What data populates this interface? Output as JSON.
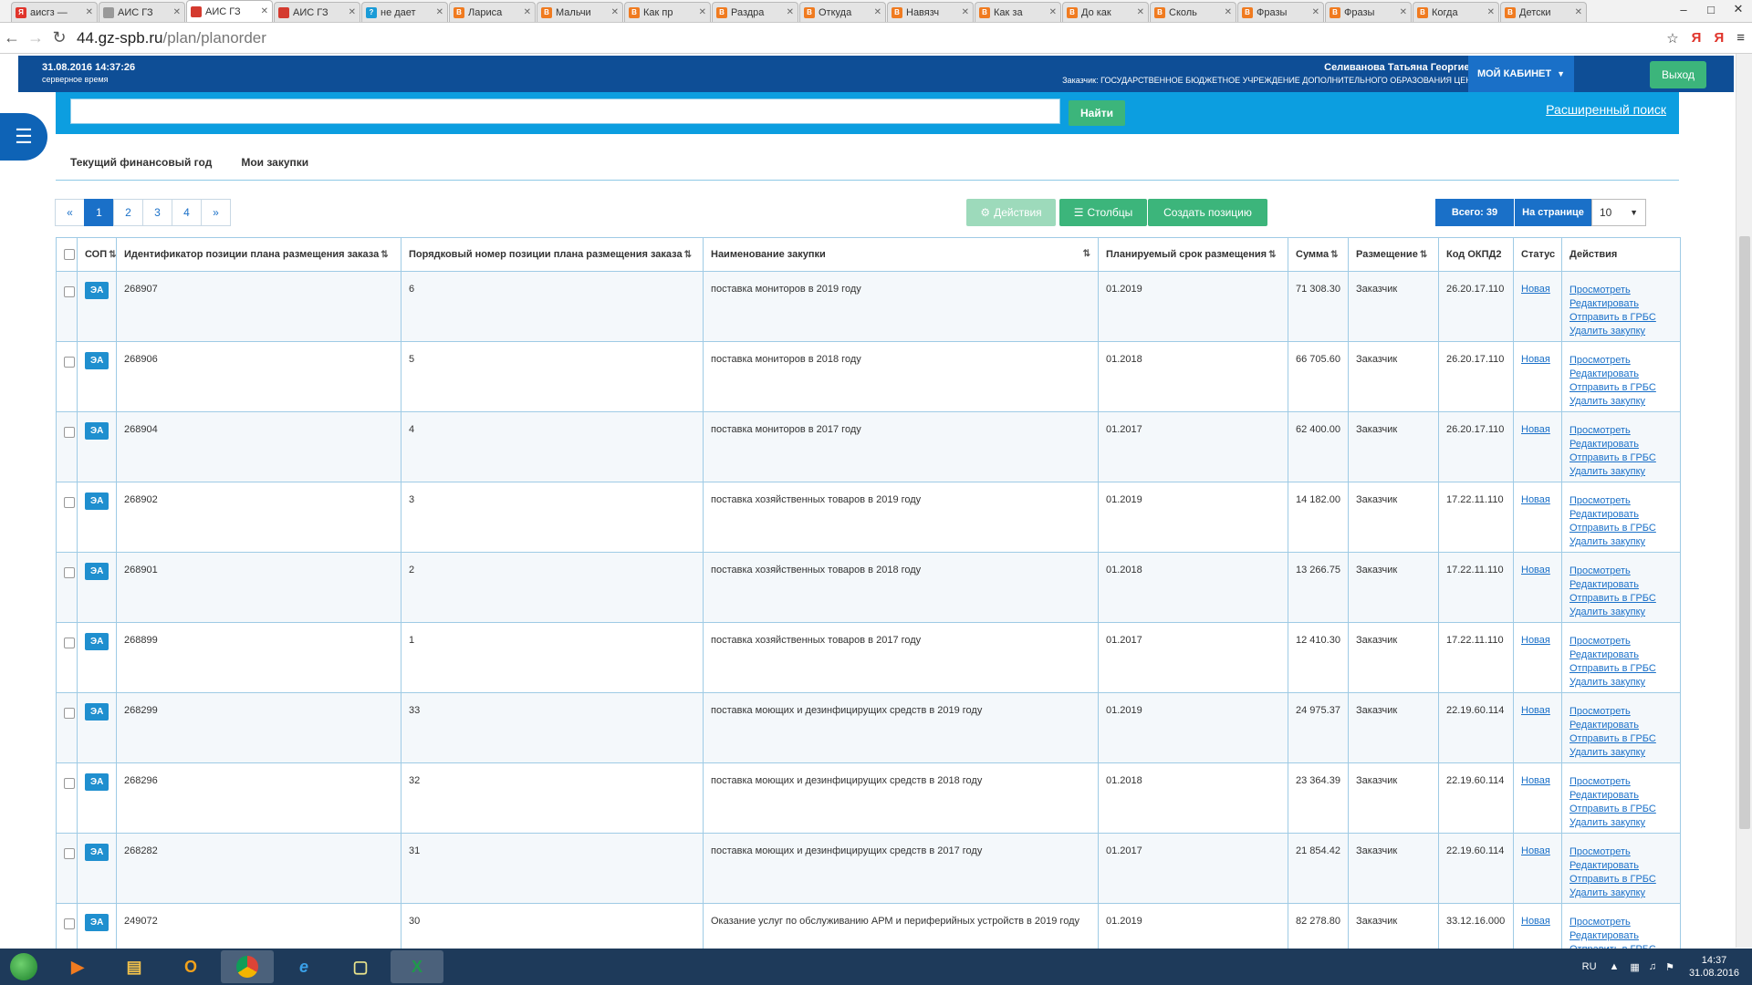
{
  "browser": {
    "tabs": [
      {
        "title": "аисгз —",
        "color": "#e0342b",
        "glyph": "Я",
        "active": false
      },
      {
        "title": "АИС ГЗ",
        "color": "#999999",
        "glyph": "",
        "active": false
      },
      {
        "title": "АИС ГЗ",
        "color": "#d43a2f",
        "glyph": "",
        "active": true
      },
      {
        "title": "АИС ГЗ",
        "color": "#d43a2f",
        "glyph": "",
        "active": false
      },
      {
        "title": "не дает",
        "color": "#1a9bd7",
        "glyph": "?",
        "active": false
      },
      {
        "title": "Лариса",
        "color": "#f07b20",
        "glyph": "B",
        "active": false
      },
      {
        "title": "Мальчи",
        "color": "#f07b20",
        "glyph": "B",
        "active": false
      },
      {
        "title": "Как пр",
        "color": "#f07b20",
        "glyph": "B",
        "active": false
      },
      {
        "title": "Раздра",
        "color": "#f07b20",
        "glyph": "B",
        "active": false
      },
      {
        "title": "Откуда",
        "color": "#f07b20",
        "glyph": "B",
        "active": false
      },
      {
        "title": "Навязч",
        "color": "#f07b20",
        "glyph": "B",
        "active": false
      },
      {
        "title": "Как за",
        "color": "#f07b20",
        "glyph": "B",
        "active": false
      },
      {
        "title": "До как",
        "color": "#f07b20",
        "glyph": "B",
        "active": false
      },
      {
        "title": "Сколь",
        "color": "#f07b20",
        "glyph": "B",
        "active": false
      },
      {
        "title": "Фразы",
        "color": "#f07b20",
        "glyph": "B",
        "active": false
      },
      {
        "title": "Фразы",
        "color": "#f07b20",
        "glyph": "B",
        "active": false
      },
      {
        "title": "Когда",
        "color": "#f07b20",
        "glyph": "B",
        "active": false
      },
      {
        "title": "Детски",
        "color": "#f07b20",
        "glyph": "B",
        "active": false
      }
    ],
    "url_host": "44.gz-spb.ru",
    "url_path": "/plan/planorder"
  },
  "header": {
    "server_time": "31.08.2016 14:37:26",
    "server_time_label": "серверное время",
    "user_name": "Селиванова Татьяна Георгиевна",
    "customer": "Заказчик: ГОСУДАРСТВЕННОЕ БЮДЖЕТНОЕ УЧРЕЖДЕНИЕ ДОПОЛНИТЕЛЬНОГО ОБРАЗОВАНИЯ ЦЕНТР...",
    "cabinet_label": "МОЙ КАБИНЕТ",
    "logout_label": "Выход"
  },
  "search": {
    "value": "",
    "button_label": "Найти",
    "advanced_label": "Расширенный поиск"
  },
  "page_tabs": [
    "Текущий финансовый год",
    "Мои закупки"
  ],
  "pager": {
    "prev": "«",
    "pages": [
      "1",
      "2",
      "3",
      "4"
    ],
    "next": "»",
    "current": "1"
  },
  "toolbar": {
    "actions_label": "Действия",
    "columns_label": "Столбцы",
    "create_label": "Создать позицию",
    "total_label": "Всего: 39",
    "per_page_label": "На странице",
    "per_page_value": "10"
  },
  "table": {
    "columns": [
      "СОП",
      "Идентификатор позиции плана размещения заказа",
      "Порядковый номер позиции плана размещения заказа",
      "Наименование закупки",
      "Планируемый срок размещения",
      "Сумма",
      "Размещение",
      "Код ОКПД2",
      "Статус",
      "Действия"
    ],
    "action_links": [
      "Просмотреть",
      "Редактировать",
      "Отправить в ГРБС",
      "Удалить закупку"
    ],
    "rows": [
      {
        "sop": "ЭА",
        "id": "268907",
        "num": "6",
        "name": "поставка мониторов в 2019 году",
        "term": "01.2019",
        "sum": "71 308.30",
        "placement": "Заказчик",
        "okpd": "26.20.17.110",
        "status": "Новая"
      },
      {
        "sop": "ЭА",
        "id": "268906",
        "num": "5",
        "name": "поставка мониторов в 2018 году",
        "term": "01.2018",
        "sum": "66 705.60",
        "placement": "Заказчик",
        "okpd": "26.20.17.110",
        "status": "Новая"
      },
      {
        "sop": "ЭА",
        "id": "268904",
        "num": "4",
        "name": "поставка мониторов в 2017 году",
        "term": "01.2017",
        "sum": "62 400.00",
        "placement": "Заказчик",
        "okpd": "26.20.17.110",
        "status": "Новая"
      },
      {
        "sop": "ЭА",
        "id": "268902",
        "num": "3",
        "name": "поставка хозяйственных товаров в 2019 году",
        "term": "01.2019",
        "sum": "14 182.00",
        "placement": "Заказчик",
        "okpd": "17.22.11.110",
        "status": "Новая"
      },
      {
        "sop": "ЭА",
        "id": "268901",
        "num": "2",
        "name": "поставка хозяйственных товаров в 2018 году",
        "term": "01.2018",
        "sum": "13 266.75",
        "placement": "Заказчик",
        "okpd": "17.22.11.110",
        "status": "Новая"
      },
      {
        "sop": "ЭА",
        "id": "268899",
        "num": "1",
        "name": "поставка хозяйственных товаров в 2017 году",
        "term": "01.2017",
        "sum": "12 410.30",
        "placement": "Заказчик",
        "okpd": "17.22.11.110",
        "status": "Новая"
      },
      {
        "sop": "ЭА",
        "id": "268299",
        "num": "33",
        "name": "поставка моющих и дезинфицирущих средств в 2019 году",
        "term": "01.2019",
        "sum": "24 975.37",
        "placement": "Заказчик",
        "okpd": "22.19.60.114",
        "status": "Новая"
      },
      {
        "sop": "ЭА",
        "id": "268296",
        "num": "32",
        "name": "поставка моющих и дезинфицирущих средств в 2018 году",
        "term": "01.2018",
        "sum": "23 364.39",
        "placement": "Заказчик",
        "okpd": "22.19.60.114",
        "status": "Новая"
      },
      {
        "sop": "ЭА",
        "id": "268282",
        "num": "31",
        "name": "поставка моющих и дезинфицирущих средств в 2017 году",
        "term": "01.2017",
        "sum": "21 854.42",
        "placement": "Заказчик",
        "okpd": "22.19.60.114",
        "status": "Новая"
      },
      {
        "sop": "ЭА",
        "id": "249072",
        "num": "30",
        "name": "Оказание услуг по обслуживанию АРМ и периферийных устройств в 2019 году",
        "term": "01.2019",
        "sum": "82 278.80",
        "placement": "Заказчик",
        "okpd": "33.12.16.000",
        "status": "Новая"
      }
    ]
  },
  "taskbar": {
    "lang": "RU",
    "time": "14:37",
    "date": "31.08.2016"
  },
  "colors": {
    "header_blue": "#0e4e96",
    "search_band": "#0c9ee0",
    "green_button": "#3cb57b",
    "link_blue": "#1a70c8"
  }
}
